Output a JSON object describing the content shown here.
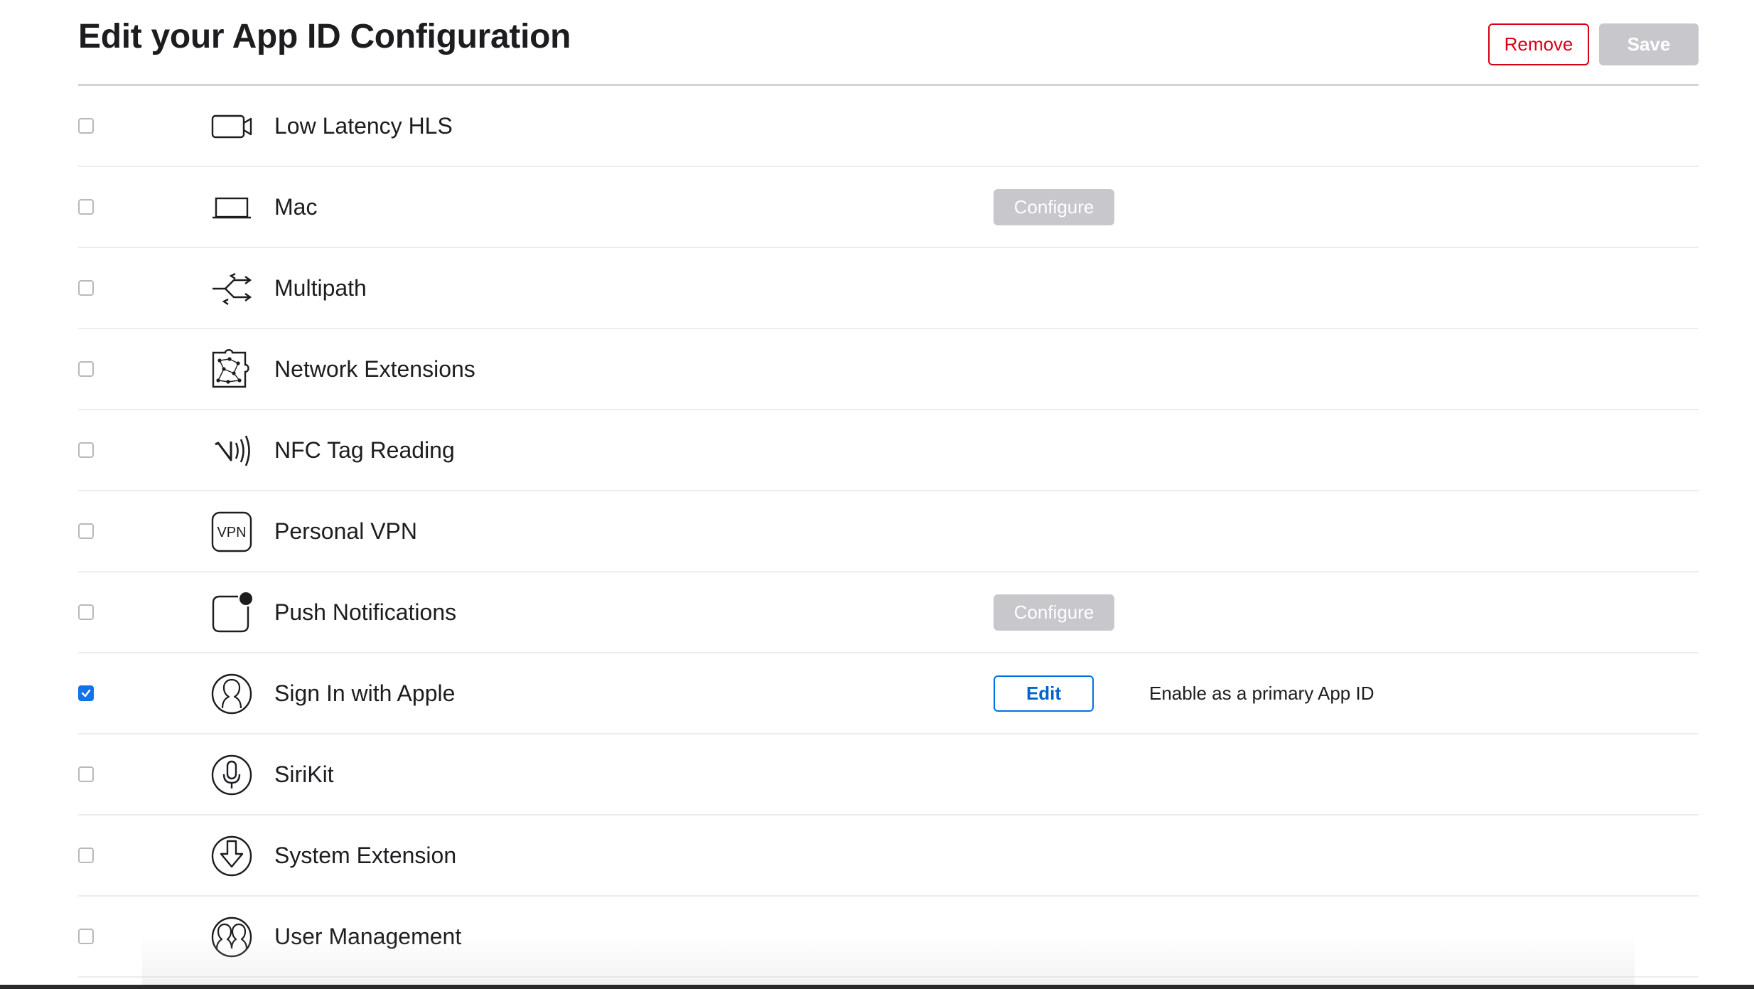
{
  "header": {
    "title": "Edit your App ID Configuration",
    "remove_label": "Remove",
    "save_label": "Save"
  },
  "colors": {
    "remove_accent": "#d70015",
    "disabled_button": "#c7c7cc",
    "checkbox_checked": "#1473e6",
    "edit_accent": "#0071e3"
  },
  "capabilities": [
    {
      "label": "Low Latency HLS",
      "icon": "video-camera-icon",
      "checked": false
    },
    {
      "label": "Mac",
      "icon": "laptop-icon",
      "checked": false,
      "action_label": "Configure"
    },
    {
      "label": "Multipath",
      "icon": "multipath-arrows-icon",
      "checked": false
    },
    {
      "label": "Network Extensions",
      "icon": "network-extension-icon",
      "checked": false
    },
    {
      "label": "NFC Tag Reading",
      "icon": "nfc-icon",
      "checked": false
    },
    {
      "label": "Personal VPN",
      "icon": "vpn-icon",
      "checked": false
    },
    {
      "label": "Push Notifications",
      "icon": "push-notification-icon",
      "checked": false,
      "action_label": "Configure"
    },
    {
      "label": "Sign In with Apple",
      "icon": "person-circle-icon",
      "checked": true,
      "action_label": "Edit",
      "note": "Enable as a primary App ID"
    },
    {
      "label": "SiriKit",
      "icon": "microphone-icon",
      "checked": false
    },
    {
      "label": "System Extension",
      "icon": "download-circle-icon",
      "checked": false
    },
    {
      "label": "User Management",
      "icon": "users-circle-icon",
      "checked": false
    }
  ]
}
